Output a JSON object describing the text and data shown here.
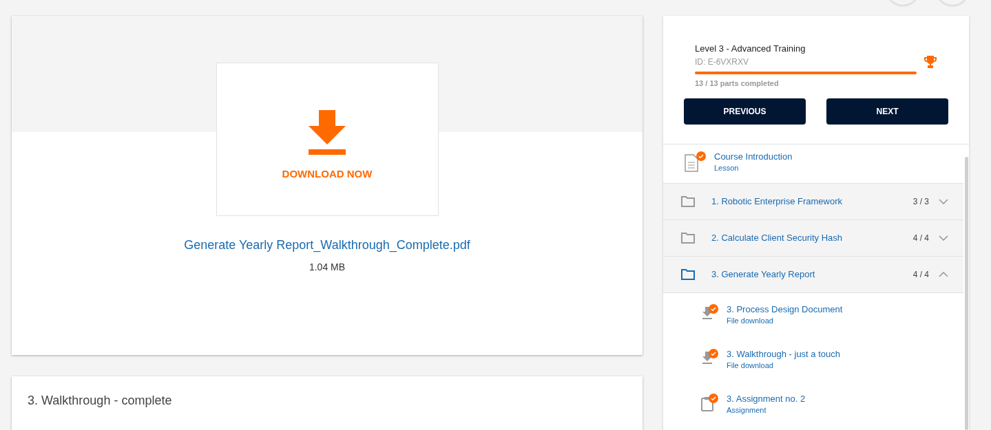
{
  "download": {
    "action": "DOWNLOAD NOW",
    "file_name": "Generate Yearly Report_Walkthrough_Complete.pdf",
    "size": "1.04 MB"
  },
  "next_card": {
    "title": "3. Walkthrough - complete"
  },
  "course": {
    "title": "Level 3 - Advanced Training",
    "id": "ID: E-6VXRXV",
    "level": 1,
    "progress_text": "13 / 13 parts completed"
  },
  "nav_buttons": [
    "PREVIOUS",
    "NEXT"
  ],
  "outline": [
    {
      "kind": "lesson",
      "title": "Course Introduction",
      "subtitle": "Lesson",
      "completed": true
    },
    {
      "kind": "section",
      "title": "1. Robotic Enterprise Framework",
      "count": "3 / 3",
      "expanded": false
    },
    {
      "kind": "section",
      "title": "2. Calculate Client Security Hash",
      "count": "4 / 4",
      "expanded": false
    },
    {
      "kind": "section",
      "title": "3. Generate Yearly Report",
      "count": "4 / 4",
      "expanded": true,
      "children": [
        {
          "kind": "download",
          "title": "3. Process Design Document",
          "subtitle": "File download",
          "completed": true
        },
        {
          "kind": "download",
          "title": "3. Walkthrough - just a touch",
          "subtitle": "File download",
          "completed": true
        },
        {
          "kind": "assignment",
          "title": "3. Assignment no. 2",
          "subtitle": "Assignment",
          "completed": true
        }
      ]
    }
  ]
}
